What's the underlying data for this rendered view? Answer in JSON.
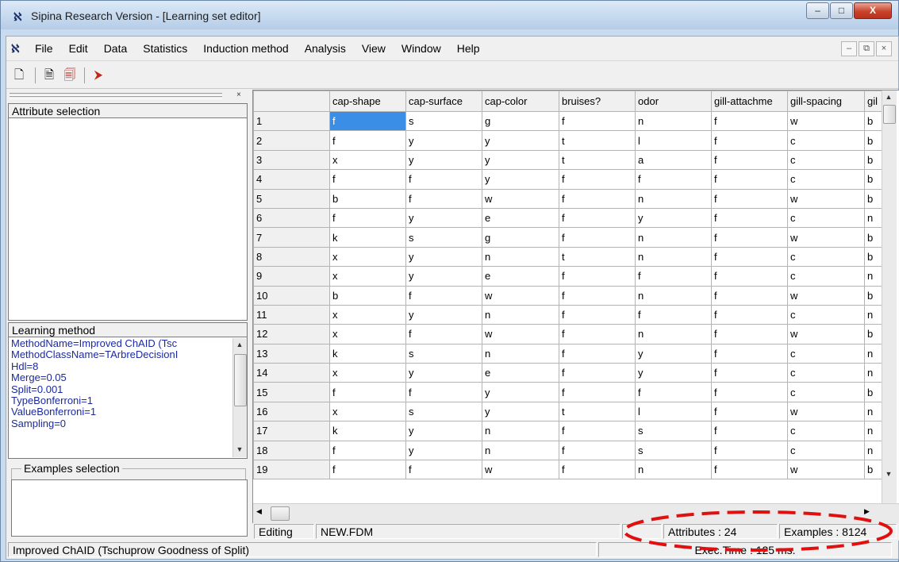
{
  "window": {
    "title": "Sipina Research Version - [Learning set editor]",
    "controls": {
      "minimize": "–",
      "maximize": "□",
      "close": "X"
    }
  },
  "menubar": {
    "items": [
      "File",
      "Edit",
      "Data",
      "Statistics",
      "Induction method",
      "Analysis",
      "View",
      "Window",
      "Help"
    ],
    "mdi_controls": {
      "minimize": "–",
      "restore": "⧉",
      "close": "×"
    }
  },
  "toolbar": {
    "buttons": [
      {
        "name": "new-file-icon",
        "glyph": "🗋"
      },
      {
        "name": "open-file-icon",
        "glyph": "🗎"
      },
      {
        "name": "copy-file-icon",
        "glyph": "🗐"
      },
      {
        "name": "execute-icon",
        "glyph": "⮞"
      }
    ]
  },
  "left_panel": {
    "close_glyph": "×",
    "attribute_selection_title": "Attribute selection",
    "learning_method_title": "Learning method",
    "learning_method_params": [
      "MethodName=Improved ChAID (Tsc",
      "MethodClassName=TArbreDecisionI",
      "Hdl=8",
      "Merge=0.05",
      "Split=0.001",
      "TypeBonferroni=1",
      "ValueBonferroni=1",
      "Sampling=0"
    ],
    "examples_selection_title": "Examples selection"
  },
  "grid": {
    "columns": [
      "cap-shape",
      "cap-surface",
      "cap-color",
      "bruises?",
      "odor",
      "gill-attachme",
      "gill-spacing",
      "gil"
    ],
    "rows": [
      [
        "1",
        "f",
        "s",
        "g",
        "f",
        "n",
        "f",
        "w",
        "b"
      ],
      [
        "2",
        "f",
        "y",
        "y",
        "t",
        "l",
        "f",
        "c",
        "b"
      ],
      [
        "3",
        "x",
        "y",
        "y",
        "t",
        "a",
        "f",
        "c",
        "b"
      ],
      [
        "4",
        "f",
        "f",
        "y",
        "f",
        "f",
        "f",
        "c",
        "b"
      ],
      [
        "5",
        "b",
        "f",
        "w",
        "f",
        "n",
        "f",
        "w",
        "b"
      ],
      [
        "6",
        "f",
        "y",
        "e",
        "f",
        "y",
        "f",
        "c",
        "n"
      ],
      [
        "7",
        "k",
        "s",
        "g",
        "f",
        "n",
        "f",
        "w",
        "b"
      ],
      [
        "8",
        "x",
        "y",
        "n",
        "t",
        "n",
        "f",
        "c",
        "b"
      ],
      [
        "9",
        "x",
        "y",
        "e",
        "f",
        "f",
        "f",
        "c",
        "n"
      ],
      [
        "10",
        "b",
        "f",
        "w",
        "f",
        "n",
        "f",
        "w",
        "b"
      ],
      [
        "11",
        "x",
        "y",
        "n",
        "f",
        "f",
        "f",
        "c",
        "n"
      ],
      [
        "12",
        "x",
        "f",
        "w",
        "f",
        "n",
        "f",
        "w",
        "b"
      ],
      [
        "13",
        "k",
        "s",
        "n",
        "f",
        "y",
        "f",
        "c",
        "n"
      ],
      [
        "14",
        "x",
        "y",
        "e",
        "f",
        "y",
        "f",
        "c",
        "n"
      ],
      [
        "15",
        "f",
        "f",
        "y",
        "f",
        "f",
        "f",
        "c",
        "b"
      ],
      [
        "16",
        "x",
        "s",
        "y",
        "t",
        "l",
        "f",
        "w",
        "n"
      ],
      [
        "17",
        "k",
        "y",
        "n",
        "f",
        "s",
        "f",
        "c",
        "n"
      ],
      [
        "18",
        "f",
        "y",
        "n",
        "f",
        "s",
        "f",
        "c",
        "n"
      ],
      [
        "19",
        "f",
        "f",
        "w",
        "f",
        "n",
        "f",
        "w",
        "b"
      ]
    ]
  },
  "status": {
    "mode": "Editing",
    "file": "NEW.FDM",
    "attributes": "Attributes : 24",
    "examples": "Examples : 8124",
    "method": "Improved ChAID (Tschuprow Goodness of Split)",
    "exec_time": "Exec.Time : 125 ms."
  },
  "colors": {
    "selection": "#3a8ee6",
    "params_text": "#1a2aa0",
    "annotation": "#e01010"
  }
}
